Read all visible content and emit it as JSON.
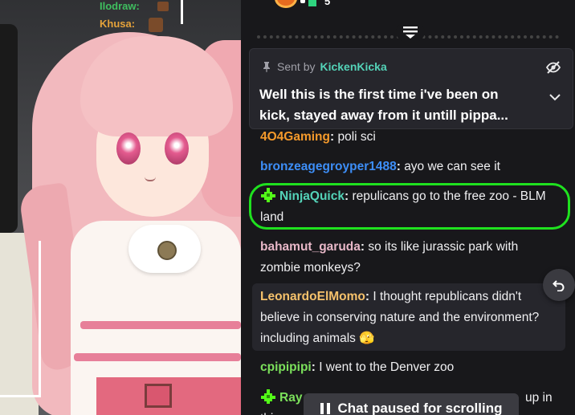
{
  "stream": {
    "chat_overlay": [
      {
        "user": "Ilodraw:",
        "color": "#3fbf5f"
      },
      {
        "user": "Khusa:",
        "color": "#e5a23a"
      }
    ]
  },
  "top_bar": {
    "gift_count": "5"
  },
  "pinned": {
    "sent_by_label": "Sent by",
    "sender": "KickenKicka",
    "text": "Well this is the first time i've been on kick, stayed away from it untill pippa..."
  },
  "messages": [
    {
      "user": "4O4Gaming",
      "user_color": "#f59a2b",
      "text": "poli sci",
      "badge": false
    },
    {
      "user": "bronzeagegroyper1488",
      "user_color": "#3d8ef7",
      "text": "ayo we can see it",
      "badge": false
    },
    {
      "user": "NinjaQuick",
      "user_color": "#54d3b8",
      "text": "repulicans go to the free zoo - BLM land",
      "badge": true
    },
    {
      "user": "bahamut_garuda",
      "user_color": "#e8b8c8",
      "text": "so its like jurassic park with zombie monkeys?",
      "badge": false
    },
    {
      "user": "LeonardoElMomo",
      "user_color": "#f5c16b",
      "text": "I thought republicans didn't believe in conserving nature and the environment? including animals 🫣",
      "badge": false
    },
    {
      "user": "cpipipipi",
      "user_color": "#7be05b",
      "text": "I went to the Denver zoo",
      "badge": false
    },
    {
      "user": "Ray",
      "user_color": "#7be05b",
      "text": "",
      "badge": true
    }
  ],
  "partial_message": {
    "tail": "up in",
    "line2": "thi"
  },
  "paused": {
    "label": "Chat paused for scrolling"
  },
  "colors": {
    "highlight": "#1fe11f",
    "kick_green": "#53fc18"
  }
}
